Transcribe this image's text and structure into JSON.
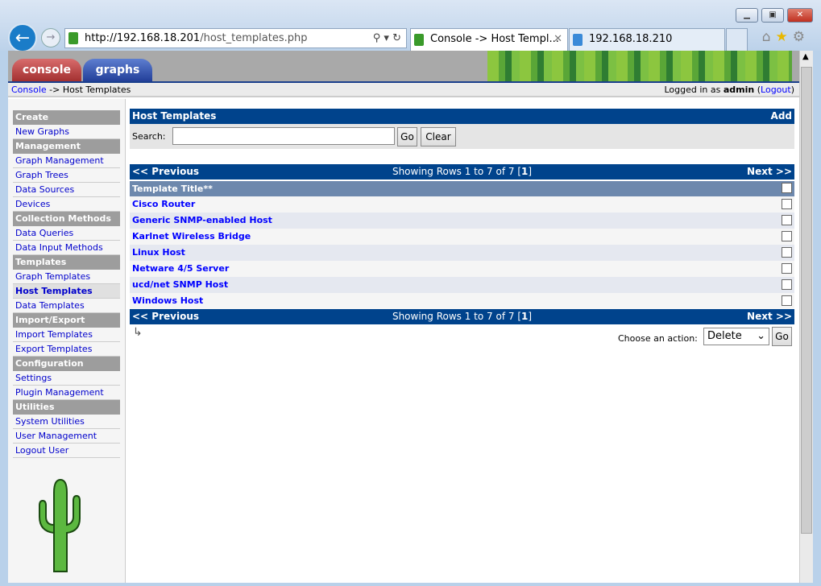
{
  "browser": {
    "url_host": "http://192.168.18.201",
    "url_path": "/host_templates.php",
    "tabs": [
      {
        "title": "Console -> Host Templ..."
      },
      {
        "title": "192.168.18.210"
      }
    ]
  },
  "nav": {
    "console": "console",
    "graphs": "graphs"
  },
  "breadcrumb": {
    "root": "Console",
    "sep": " -> ",
    "current": "Host Templates",
    "logged_prefix": "Logged in as ",
    "user": "admin",
    "logout": "Logout"
  },
  "sidebar": [
    {
      "label": "Create",
      "type": "header"
    },
    {
      "label": "New Graphs",
      "type": "link"
    },
    {
      "label": "Management",
      "type": "header"
    },
    {
      "label": "Graph Management",
      "type": "link"
    },
    {
      "label": "Graph Trees",
      "type": "link"
    },
    {
      "label": "Data Sources",
      "type": "link"
    },
    {
      "label": "Devices",
      "type": "link"
    },
    {
      "label": "Collection Methods",
      "type": "header"
    },
    {
      "label": "Data Queries",
      "type": "link"
    },
    {
      "label": "Data Input Methods",
      "type": "link"
    },
    {
      "label": "Templates",
      "type": "header"
    },
    {
      "label": "Graph Templates",
      "type": "link"
    },
    {
      "label": "Host Templates",
      "type": "link",
      "selected": true
    },
    {
      "label": "Data Templates",
      "type": "link"
    },
    {
      "label": "Import/Export",
      "type": "header"
    },
    {
      "label": "Import Templates",
      "type": "link"
    },
    {
      "label": "Export Templates",
      "type": "link"
    },
    {
      "label": "Configuration",
      "type": "header"
    },
    {
      "label": "Settings",
      "type": "link"
    },
    {
      "label": "Plugin Management",
      "type": "link"
    },
    {
      "label": "Utilities",
      "type": "header"
    },
    {
      "label": "System Utilities",
      "type": "link"
    },
    {
      "label": "User Management",
      "type": "link"
    },
    {
      "label": "Logout User",
      "type": "link"
    }
  ],
  "main": {
    "title": "Host Templates",
    "add": "Add",
    "search_label": "Search:",
    "search_value": "",
    "go": "Go",
    "clear": "Clear",
    "prev": "<< Previous",
    "next": "Next >>",
    "showing": "Showing Rows 1 to 7 of 7 [",
    "page": "1",
    "showing_end": "]",
    "column": "Template Title**",
    "rows": [
      "Cisco Router",
      "Generic SNMP-enabled Host",
      "Karlnet Wireless Bridge",
      "Linux Host",
      "Netware 4/5 Server",
      "ucd/net SNMP Host",
      "Windows Host"
    ],
    "action_label": "Choose an action:",
    "action_value": "Delete",
    "action_go": "Go"
  },
  "colors": {
    "header_blue": "#00438c",
    "column_header": "#6d88ad",
    "link": "#0000ff"
  }
}
